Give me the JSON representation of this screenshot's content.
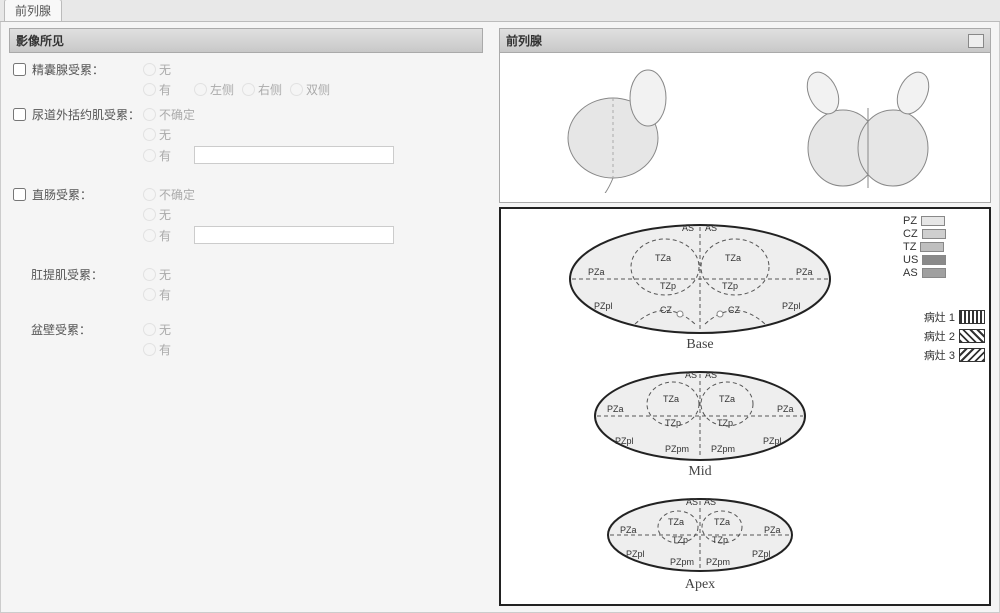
{
  "tab": {
    "title": "前列腺"
  },
  "left": {
    "header": "影像所见",
    "items": [
      {
        "label": "精囊腺受累：",
        "checkbox": true,
        "options": [
          "无",
          "有"
        ],
        "side_options": [
          "左侧",
          "右侧",
          "双侧"
        ]
      },
      {
        "label": "尿道外括约肌受累：",
        "checkbox": true,
        "options": [
          "不确定",
          "无",
          "有"
        ],
        "textfield": true
      },
      {
        "label": "直肠受累：",
        "checkbox": true,
        "options": [
          "不确定",
          "无",
          "有"
        ],
        "textfield": true
      },
      {
        "label": "肛提肌受累：",
        "checkbox": false,
        "options": [
          "无",
          "有"
        ]
      },
      {
        "label": "盆壁受累：",
        "checkbox": false,
        "options": [
          "无",
          "有"
        ]
      }
    ]
  },
  "right": {
    "header": "前列腺",
    "zone_legend": [
      {
        "name": "PZ",
        "color": "#e6e6e6"
      },
      {
        "name": "CZ",
        "color": "#cfcfcf"
      },
      {
        "name": "TZ",
        "color": "#bfbfbf"
      },
      {
        "name": "US",
        "color": "#8a8a8a"
      },
      {
        "name": "AS",
        "color": "#a0a0a0"
      }
    ],
    "lesion_legend": [
      {
        "label": "病灶 1",
        "pattern": "vstripes"
      },
      {
        "label": "病灶 2",
        "pattern": "diag1"
      },
      {
        "label": "病灶 3",
        "pattern": "diag2"
      }
    ],
    "sections": [
      {
        "name": "Base",
        "labels": [
          "AS",
          "AS",
          "TZa",
          "TZa",
          "PZa",
          "PZa",
          "TZp",
          "TZp",
          "CZ",
          "CZ",
          "PZpl",
          "PZpl"
        ]
      },
      {
        "name": "Mid",
        "labels": [
          "AS",
          "AS",
          "TZa",
          "TZa",
          "PZa",
          "PZa",
          "TZp",
          "TZp",
          "PZpl",
          "PZpm",
          "PZpm",
          "PZpl"
        ]
      },
      {
        "name": "Apex",
        "labels": [
          "AS",
          "AS",
          "TZa",
          "TZa",
          "PZa",
          "TZp",
          "TZp",
          "PZa",
          "PZpl",
          "PZpm",
          "PZpm",
          "PZpl"
        ]
      }
    ]
  }
}
